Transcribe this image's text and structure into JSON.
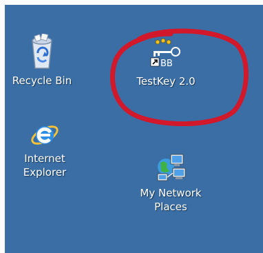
{
  "desktop": {
    "background": "#3a6ea5",
    "highlight_color": "#d2192b",
    "icons": [
      {
        "name": "recycle-bin",
        "label": "Recycle Bin",
        "icon": "recycle-bin-icon"
      },
      {
        "name": "testkey",
        "label": "TestKey 2.0",
        "icon": "testkey-icon",
        "badge_text": "BB",
        "shortcut": true
      },
      {
        "name": "internet-explorer",
        "label": "Internet\nExplorer",
        "icon": "internet-explorer-icon"
      },
      {
        "name": "my-network-places",
        "label": "My Network\nPlaces",
        "icon": "network-places-icon"
      }
    ]
  }
}
